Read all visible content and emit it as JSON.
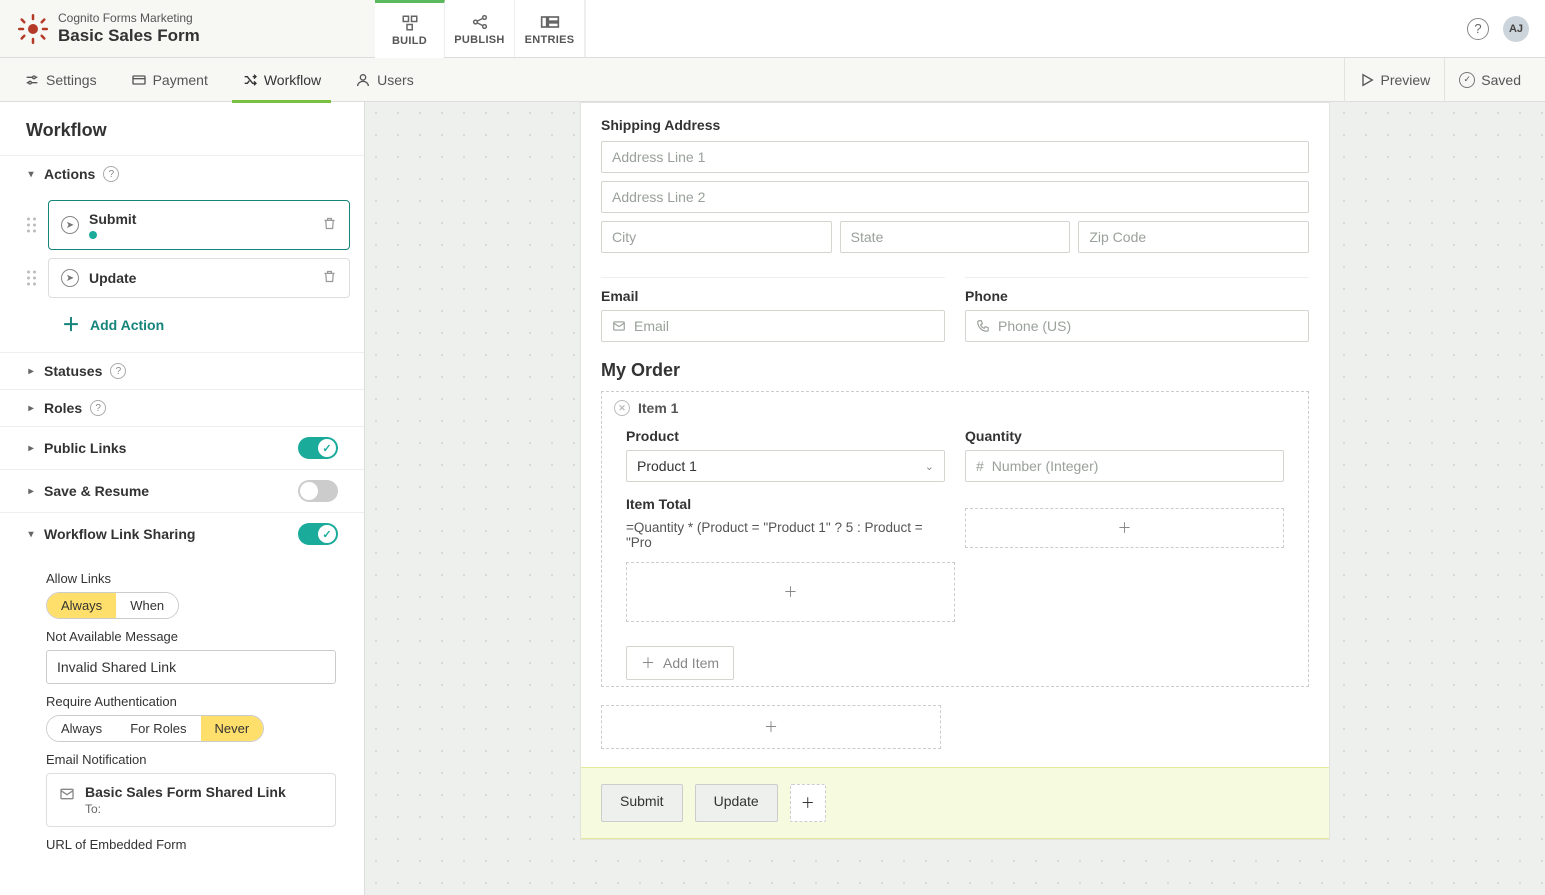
{
  "org_name": "Cognito Forms Marketing",
  "form_name": "Basic Sales Form",
  "avatar_initials": "AJ",
  "topnav": {
    "build": "BUILD",
    "publish": "PUBLISH",
    "entries": "ENTRIES"
  },
  "subnav": {
    "settings": "Settings",
    "payment": "Payment",
    "workflow": "Workflow",
    "users": "Users",
    "preview": "Preview",
    "saved": "Saved"
  },
  "sidebar": {
    "title": "Workflow",
    "actions": {
      "heading": "Actions",
      "items": [
        {
          "label": "Submit",
          "has_status": true
        },
        {
          "label": "Update",
          "has_status": false
        }
      ],
      "add_label": "Add Action"
    },
    "statuses": {
      "heading": "Statuses"
    },
    "roles": {
      "heading": "Roles"
    },
    "public_links": {
      "heading": "Public Links",
      "on": true
    },
    "save_resume": {
      "heading": "Save & Resume",
      "on": false
    },
    "link_sharing": {
      "heading": "Workflow Link Sharing",
      "on": true,
      "allow_links_label": "Allow Links",
      "allow_links_options": [
        "Always",
        "When"
      ],
      "allow_links_selected": "Always",
      "not_avail_label": "Not Available Message",
      "not_avail_value": "Invalid Shared Link",
      "req_auth_label": "Require Authentication",
      "req_auth_options": [
        "Always",
        "For Roles",
        "Never"
      ],
      "req_auth_selected": "Never",
      "email_notif_label": "Email Notification",
      "email_notif_title": "Basic Sales Form Shared Link",
      "email_notif_to": "To:",
      "url_label": "URL of Embedded Form"
    }
  },
  "form": {
    "shipping": {
      "heading": "Shipping Address",
      "addr1": "Address Line 1",
      "addr2": "Address Line 2",
      "city": "City",
      "state": "State",
      "zip": "Zip Code"
    },
    "email_label": "Email",
    "email_ph": "Email",
    "phone_label": "Phone",
    "phone_ph": "Phone (US)",
    "order_heading": "My Order",
    "item_label": "Item 1",
    "product_label": "Product",
    "product_value": "Product 1",
    "qty_label": "Quantity",
    "qty_ph": "Number (Integer)",
    "item_total_label": "Item Total",
    "formula": "=Quantity * (Product = \"Product 1\" ? 5 : Product = \"Pro",
    "add_item": "Add Item",
    "submit": "Submit",
    "update": "Update"
  }
}
